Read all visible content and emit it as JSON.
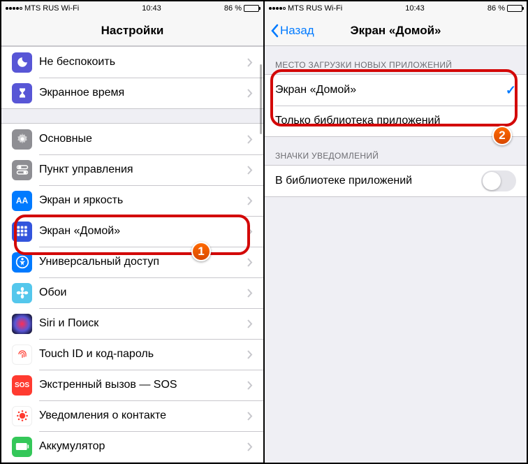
{
  "status": {
    "carrier": "MTS RUS",
    "conn": "Wi-Fi",
    "time": "10:43",
    "battery": "86 %"
  },
  "left": {
    "title": "Настройки",
    "rows": {
      "dnd": "Не беспокоить",
      "screentime": "Экранное время",
      "general": "Основные",
      "control": "Пункт управления",
      "display": "Экран и яркость",
      "home": "Экран «Домой»",
      "access": "Универсальный доступ",
      "wallpaper": "Обои",
      "siri": "Siri и Поиск",
      "touchid": "Touch ID и код-пароль",
      "sos": "Экстренный вызов — SOS",
      "exposure": "Уведомления о контакте",
      "battery": "Аккумулятор"
    }
  },
  "right": {
    "back": "Назад",
    "title": "Экран «Домой»",
    "section1": "МЕСТО ЗАГРУЗКИ НОВЫХ ПРИЛОЖЕНИЙ",
    "opt_home": "Экран «Домой»",
    "opt_lib": "Только библиотека приложений",
    "section2": "ЗНАЧКИ УВЕДОМЛЕНИЙ",
    "badges_row": "В библиотеке приложений"
  },
  "badges": {
    "b1": "1",
    "b2": "2"
  }
}
